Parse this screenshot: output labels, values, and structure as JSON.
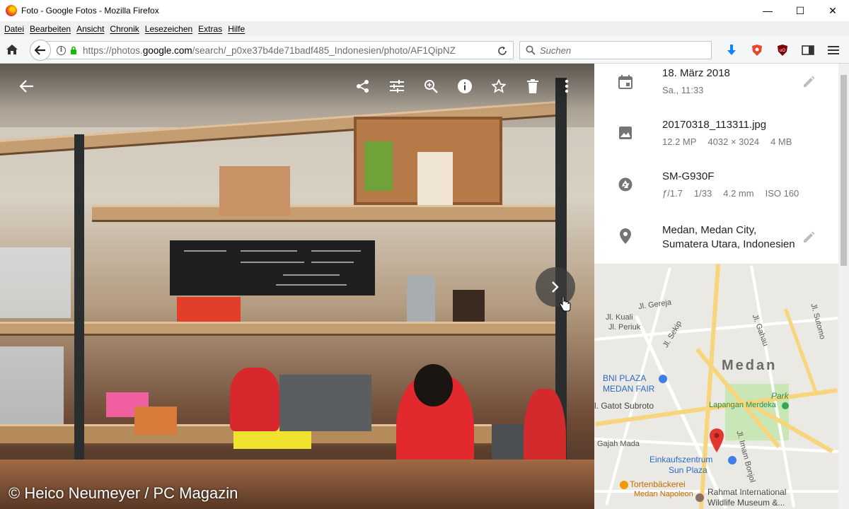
{
  "window": {
    "title": "Foto - Google Fotos - Mozilla Firefox",
    "minimize": "—",
    "maximize": "☐",
    "close": "✕"
  },
  "menu": {
    "items": [
      {
        "label": "Datei"
      },
      {
        "label": "Bearbeiten"
      },
      {
        "label": "Ansicht"
      },
      {
        "label": "Chronik"
      },
      {
        "label": "Lesezeichen"
      },
      {
        "label": "Extras"
      },
      {
        "label": "Hilfe"
      }
    ]
  },
  "nav": {
    "url_prefix": "https://photos.",
    "url_host": "google.com",
    "url_path": "/search/_p0xe37b4de71badf485_Indonesien/photo/AF1QipNZ",
    "search_placeholder": "Suchen"
  },
  "photo": {
    "watermark": "© Heico Neumeyer / PC Magazin"
  },
  "info": {
    "date": "18. März 2018",
    "time": "Sa., 11:33",
    "filename": "20170318_113311.jpg",
    "megapixels": "12.2 MP",
    "resolution": "4032 × 3024",
    "filesize": "4 MB",
    "camera": "SM-G930F",
    "aperture": "ƒ/1.7",
    "shutter": "1/33",
    "focal": "4.2 mm",
    "iso": "ISO 160",
    "location_line1": "Medan, Medan City,",
    "location_line2": "Sumatera Utara, Indonesien"
  },
  "map": {
    "labels": {
      "gereja": "Jl. Gereja",
      "kuali": "Jl. Kuali",
      "periuk": "Jl. Periuk",
      "gahau": "Jl. Gahau",
      "sutomo": "Jl. Sutomo",
      "sekip": "Jl. Sekip",
      "city": "Medan",
      "bni1": "BNI PLAZA",
      "bni2": "MEDAN FAIR",
      "park": "Park",
      "gatot": "l. Gatot Subroto",
      "lapangan": "Lapangan Merdeka",
      "gajah": "Gajah Mada",
      "imam": "Jl. Imam Bonjol",
      "einkauf1": "Einkaufszentrum",
      "einkauf2": "Sun Plaza",
      "torten1": "Tortenbäckerei",
      "torten2": "Medan Napoleon",
      "rahmat1": "Rahmat International",
      "rahmat2": "Wildlife Museum &..."
    }
  }
}
